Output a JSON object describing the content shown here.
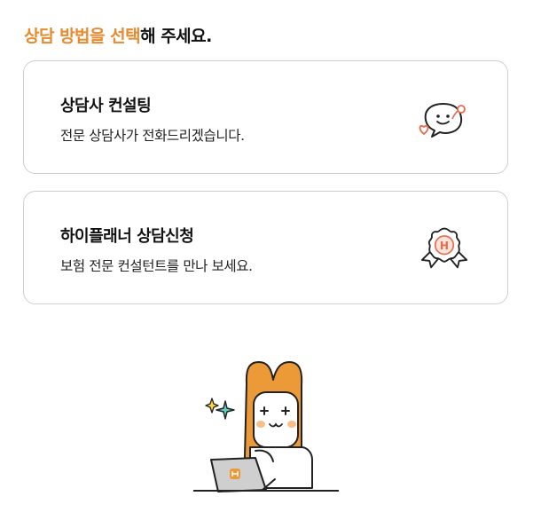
{
  "header": {
    "accent_text": "상담 방법을 선택",
    "rest_text": "해 주세요."
  },
  "options": [
    {
      "title": "상담사 컨설팅",
      "description": "전문 상담사가 전화드리겠습니다.",
      "icon": "chat-bubble-heart-icon"
    },
    {
      "title": "하이플래너 상담신청",
      "description": "보험 전문 컨설턴트를 만나 보세요.",
      "icon": "h-badge-ribbon-icon"
    }
  ],
  "mascot": {
    "icon": "orange-mascot-with-laptop"
  },
  "colors": {
    "accent": "#e88a2e",
    "border": "#cfcfcf",
    "mascot": "#ec9a37",
    "sparkle": "#5cd1c4"
  }
}
